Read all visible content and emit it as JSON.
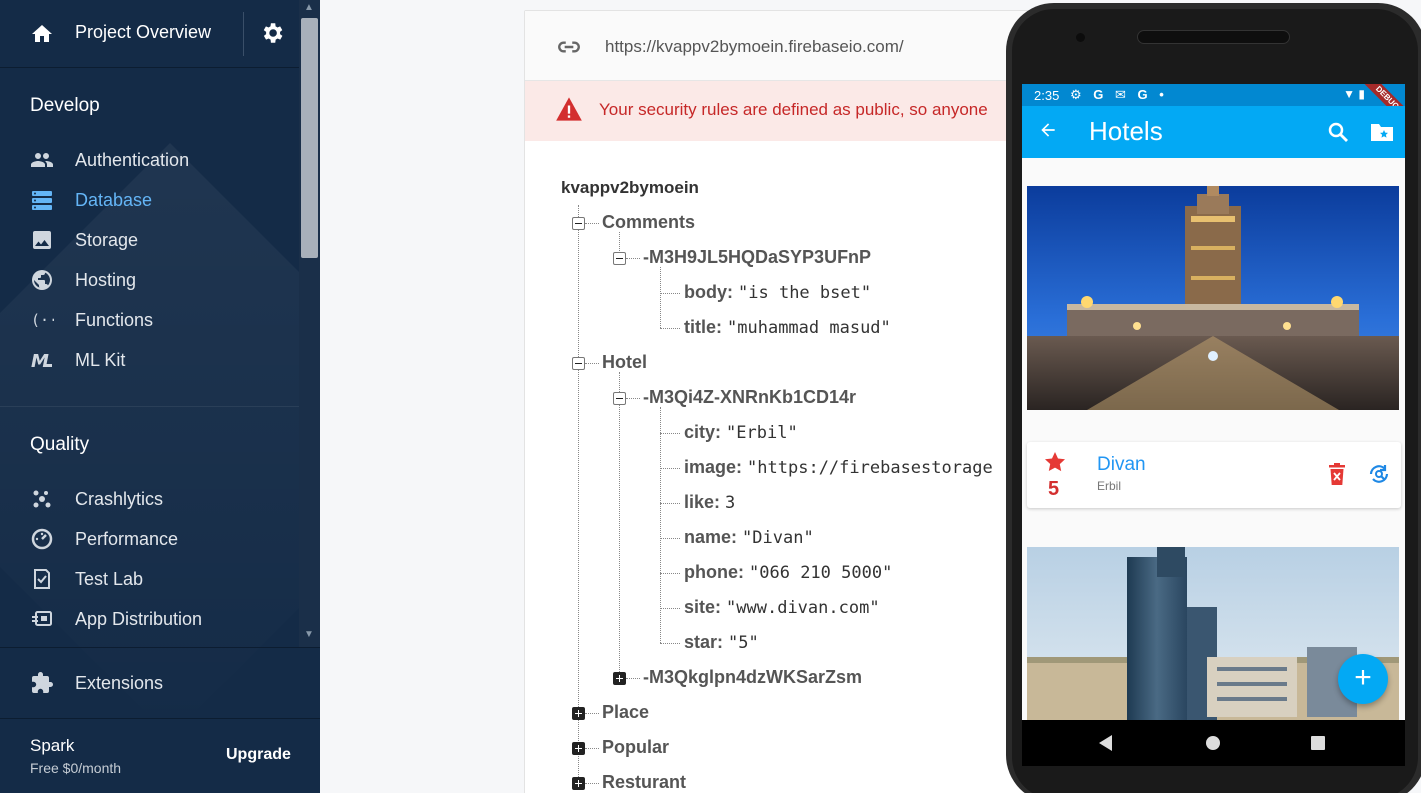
{
  "sidebar": {
    "title": "Project Overview",
    "sections": [
      {
        "heading": "Develop",
        "items": [
          {
            "label": "Authentication",
            "icon": "people-icon"
          },
          {
            "label": "Database",
            "icon": "database-icon",
            "active": true
          },
          {
            "label": "Storage",
            "icon": "image-icon"
          },
          {
            "label": "Hosting",
            "icon": "globe-icon"
          },
          {
            "label": "Functions",
            "icon": "functions-icon"
          },
          {
            "label": "ML Kit",
            "icon": "ml-kit-icon"
          }
        ]
      },
      {
        "heading": "Quality",
        "items": [
          {
            "label": "Crashlytics",
            "icon": "crashlytics-icon"
          },
          {
            "label": "Performance",
            "icon": "speedometer-icon"
          },
          {
            "label": "Test Lab",
            "icon": "checklist-icon"
          },
          {
            "label": "App Distribution",
            "icon": "app-distribution-icon"
          }
        ]
      }
    ],
    "extensions_label": "Extensions",
    "plan_name": "Spark",
    "plan_price": "Free $0/month",
    "upgrade_label": "Upgrade",
    "accent_color": "#64b5f6",
    "background": "#142b47"
  },
  "database": {
    "url": "https://kvappv2bymoein.firebaseio.com/",
    "warning": "Your security rules are defined as public, so anyone",
    "root": "kvappv2bymoein",
    "tree": {
      "comments": "Comments",
      "comment_id": "-M3H9JL5HQDaSYP3UFnP",
      "comment_body_key": "body:",
      "comment_body_val": "\"is the bset\"",
      "comment_title_key": "title:",
      "comment_title_val": "\"muhammad masud\"",
      "hotel": "Hotel",
      "hotel_id": "-M3Qi4Z-XNRnKb1CD14r",
      "fields": [
        {
          "k": "city:",
          "v": "\"Erbil\""
        },
        {
          "k": "image:",
          "v": "\"https://firebasestorage"
        },
        {
          "k": "like:",
          "v": "3"
        },
        {
          "k": "name:",
          "v": "\"Divan\""
        },
        {
          "k": "phone:",
          "v": "\"066 210 5000\""
        },
        {
          "k": "site:",
          "v": "\"www.divan.com\""
        },
        {
          "k": "star:",
          "v": "\"5\""
        }
      ],
      "hotel_id2": "-M3Qkglpn4dzWKSarZsm",
      "place": "Place",
      "popular": "Popular",
      "resturant": "Resturant"
    }
  },
  "phone": {
    "time": "2:35",
    "status_icons": "⚙ G ✉ G •",
    "debug_label": "DEBUG",
    "app_title": "Hotels",
    "hotel": {
      "name": "Divan",
      "city": "Erbil",
      "stars": "5"
    },
    "fab_label": "+",
    "primary_color": "#03a9f4"
  }
}
